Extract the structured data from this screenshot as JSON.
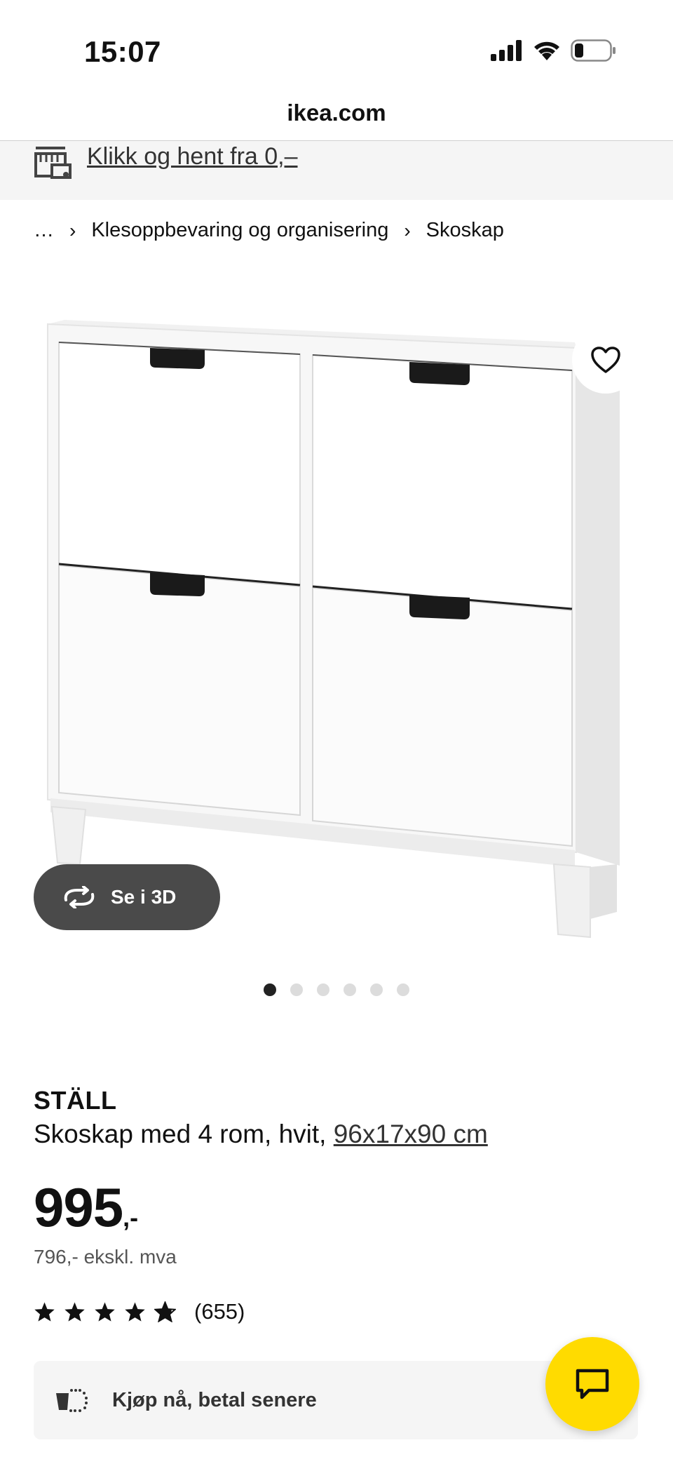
{
  "status_bar": {
    "time": "15:07"
  },
  "browser": {
    "url": "ikea.com"
  },
  "pickup_banner": {
    "label": "Klikk og hent fra 0,–"
  },
  "breadcrumb": {
    "ellipsis": "…",
    "items": [
      "Klesoppbevaring og organisering",
      "Skoskap"
    ]
  },
  "gallery": {
    "see_3d_label": "Se i 3D",
    "dot_count": 6,
    "active_index": 0
  },
  "product": {
    "name": "STÄLL",
    "description": "Skoskap med 4 rom, hvit, ",
    "dimensions": "96x17x90 cm",
    "price_integer": "995",
    "price_decimal": ",-",
    "price_ex_vat": "796,- ekskl. mva",
    "rating_value": 4.8,
    "review_count": "(655)"
  },
  "payment": {
    "label": "Kjøp nå, betal senere"
  },
  "colors": {
    "chat_button": "#ffdb00",
    "banner_bg": "#f5f5f5",
    "btn_3d_bg": "#4a4a4a"
  }
}
